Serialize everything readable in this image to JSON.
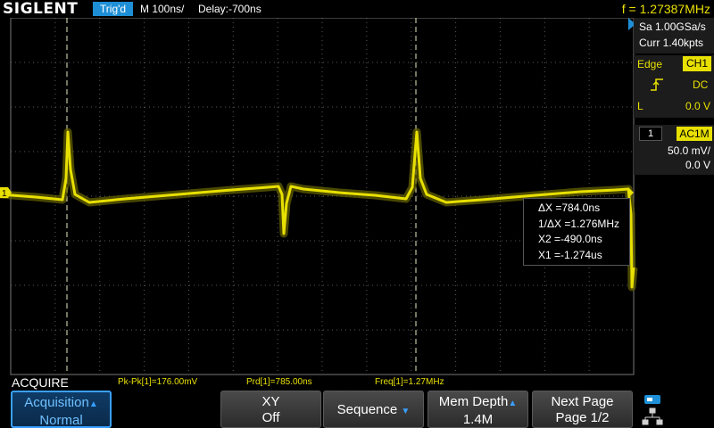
{
  "topbar": {
    "brand": "SIGLENT",
    "trigger_status": "Trig'd",
    "timebase": "M 100ns/",
    "delay": "Delay:-700ns",
    "frequency": "f = 1.27387MHz"
  },
  "acquisition_info": {
    "sample_rate": "Sa 1.00GSa/s",
    "current_points": "Curr 1.40kpts"
  },
  "trigger": {
    "type": "Edge",
    "source": "CH1",
    "coupling": "DC",
    "level_label": "L",
    "level_value": "0.0 V"
  },
  "channel": {
    "number": "1",
    "coupling": "AC1M",
    "scale": "50.0 mV/",
    "offset": "0.0 V"
  },
  "cursors": {
    "delta_x": "ΔX =784.0ns",
    "inv_delta_x": "1/ΔX =1.276MHz",
    "x2": "X2 =-490.0ns",
    "x1": "X1 =-1.274us"
  },
  "measurements": {
    "title": "ACQUIRE",
    "items": [
      "Pk-Pk[1]=176.00mV",
      "Prd[1]=785.00ns",
      "Freq[1]=1.27MHz"
    ]
  },
  "menu": {
    "acquisition": {
      "line1": "Acquisition",
      "line2": "Normal"
    },
    "xy": {
      "line1": "XY",
      "line2": "Off"
    },
    "sequence": {
      "label": "Sequence"
    },
    "mem_depth": {
      "line1": "Mem Depth",
      "line2": "1.4M"
    },
    "next_page": {
      "line1": "Next Page",
      "line2": "Page 1/2"
    }
  },
  "markers": {
    "channel_marker": "1"
  },
  "colors": {
    "trace": "#e8e000",
    "accent": "#1e8fd6",
    "grid": "#666666"
  }
}
